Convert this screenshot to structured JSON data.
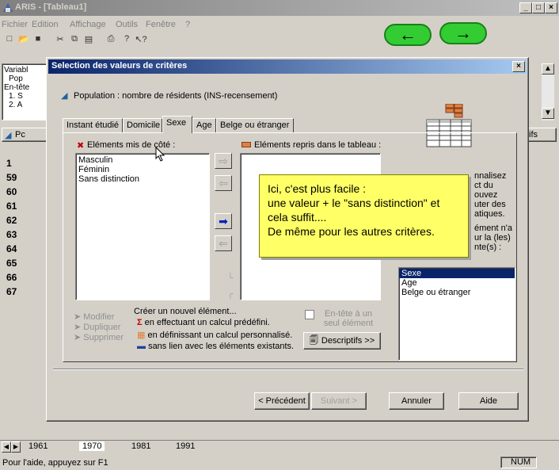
{
  "app": {
    "title": "ARIS - [Tableau1]",
    "menu": [
      "Fichier",
      "Edition",
      "Affichage",
      "Outils",
      "Fenêtre",
      "?"
    ],
    "left_panel": [
      "Variabl",
      "Pop",
      "En-tête",
      "1. S",
      "2. A"
    ],
    "left_tab": "Pc",
    "row_numbers": [
      "1",
      "59",
      "60",
      "61",
      "62",
      "63",
      "64",
      "65",
      "66",
      "67"
    ],
    "right_tab": "ifs",
    "sheet_tabs": [
      "1961",
      "1970",
      "1981",
      "1991"
    ],
    "status_text": "Pour l'aide, appuyez sur F1",
    "status_num": "NUM"
  },
  "dialog": {
    "title": "Selection des valeurs de critères",
    "population_label": "Population : nombre de résidents (INS-recensement)",
    "tabs": [
      "Instant étudié",
      "Domicile",
      "Sexe",
      "Age",
      "Belge ou étranger"
    ],
    "active_tab": "Sexe",
    "set_aside_label": "Eléments mis de côté :",
    "set_aside_items": [
      "Masculin",
      "Féminin",
      "Sans distinction"
    ],
    "kept_label": "Eléments repris dans le tableau :",
    "right_text_lines": [
      "nnalisez",
      "ct du",
      "ouvez",
      "uter des",
      "atiques.",
      "",
      "ément n'a",
      "ur la (les)",
      "nte(s) :"
    ],
    "criteria_items": [
      "Sexe",
      "Age",
      "Belge ou étranger"
    ],
    "selected_criterion": "Sexe",
    "modifier": "Modifier",
    "dupliquer": "Dupliquer",
    "supprimer": "Supprimer",
    "create_label": "Créer un nouvel élément...",
    "create_opt1": "en effectuant un calcul prédéfini.",
    "create_opt2": "en définissant un calcul personnalisé.",
    "create_opt3": "sans lien avec les éléments existants.",
    "entete_check": "En-tête à un seul élément",
    "descriptifs": "Descriptifs >>",
    "precedent": "< Précédent",
    "suivant": "Suivant >",
    "annuler": "Annuler",
    "aide": "Aide"
  },
  "tooltip": {
    "line1": "Ici, c'est plus facile :",
    "line2": " une valeur + le \"sans distinction\" et cela suffit....",
    "line3": "De même pour les autres critères."
  },
  "colors": {
    "title_blue_start": "#0a246a",
    "title_blue_end": "#a6caf0",
    "inactive_title": "#808080",
    "face": "#d4d0c8",
    "tooltip_bg": "#ffff66",
    "nav_green": "#33cc33",
    "selection": "#0a246a"
  }
}
